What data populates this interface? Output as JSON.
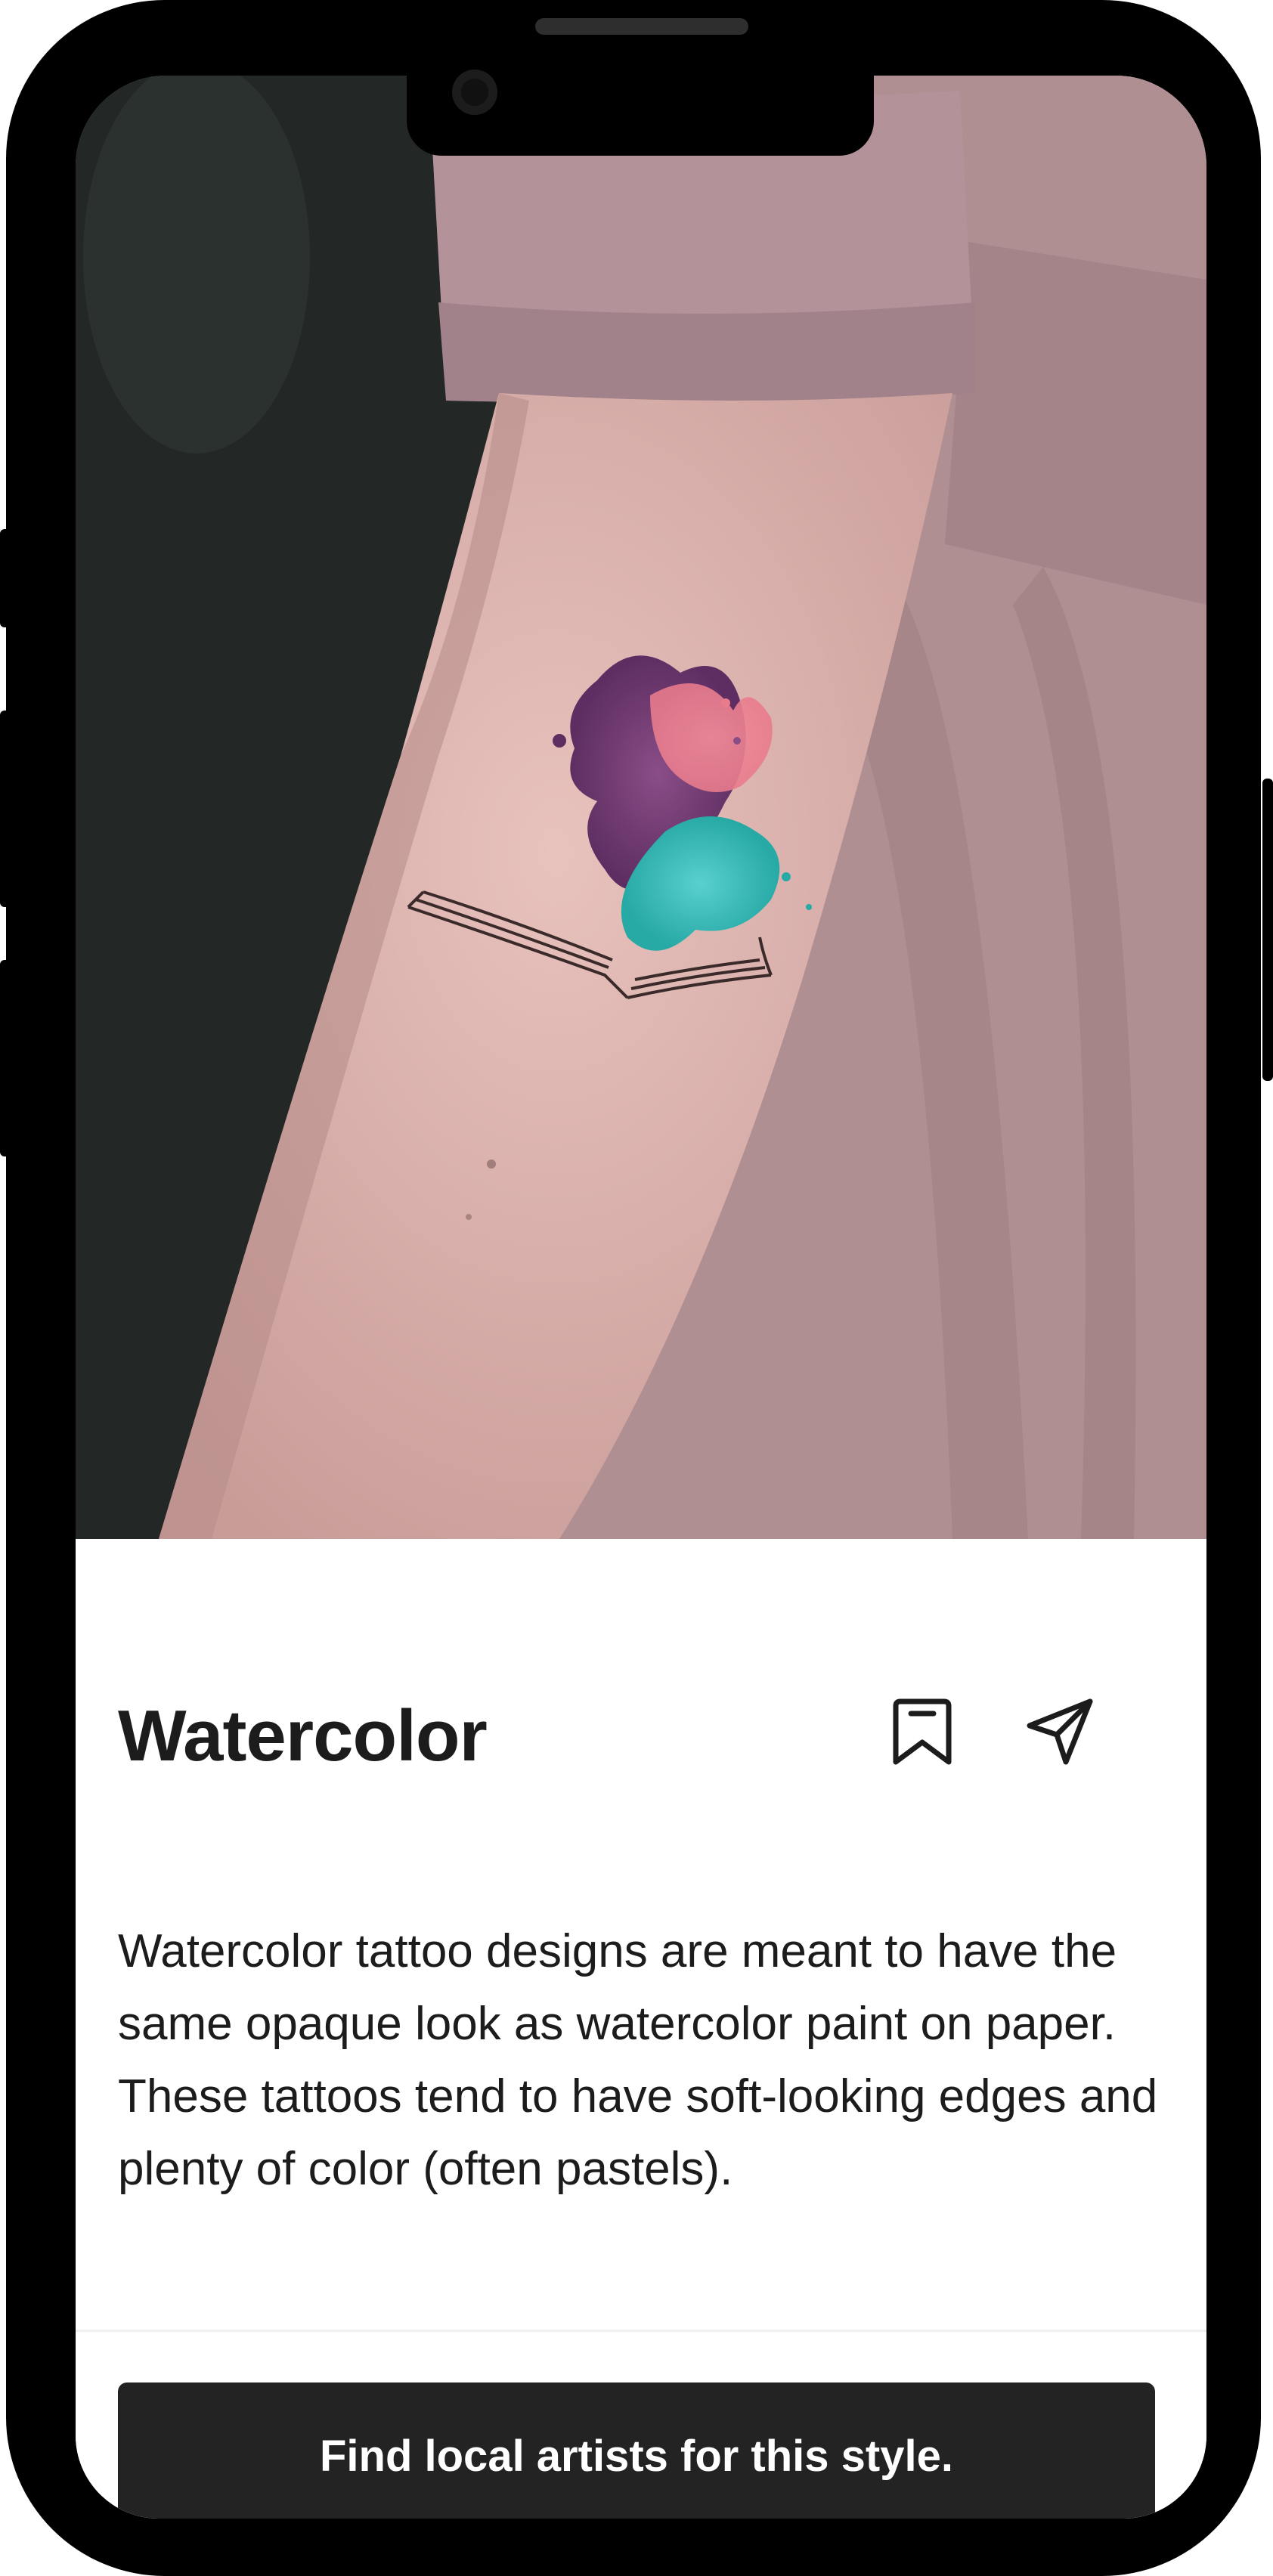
{
  "style_detail": {
    "image_alt": "Forearm with a watercolor splash tattoo rising from an open book",
    "title": "Watercolor",
    "icons": {
      "bookmark": "bookmark-icon",
      "share": "send-icon"
    },
    "description": "Watercolor tattoo designs are meant to have the same opaque look as watercolor paint on paper. These tattoos tend to have soft-looking edges and plenty of color (often pastels).",
    "cta_label": "Find local artists for this style."
  },
  "colors": {
    "frame": "#000000",
    "text": "#1c1c1c",
    "cta_background": "#232323",
    "cta_text": "#ffffff"
  }
}
